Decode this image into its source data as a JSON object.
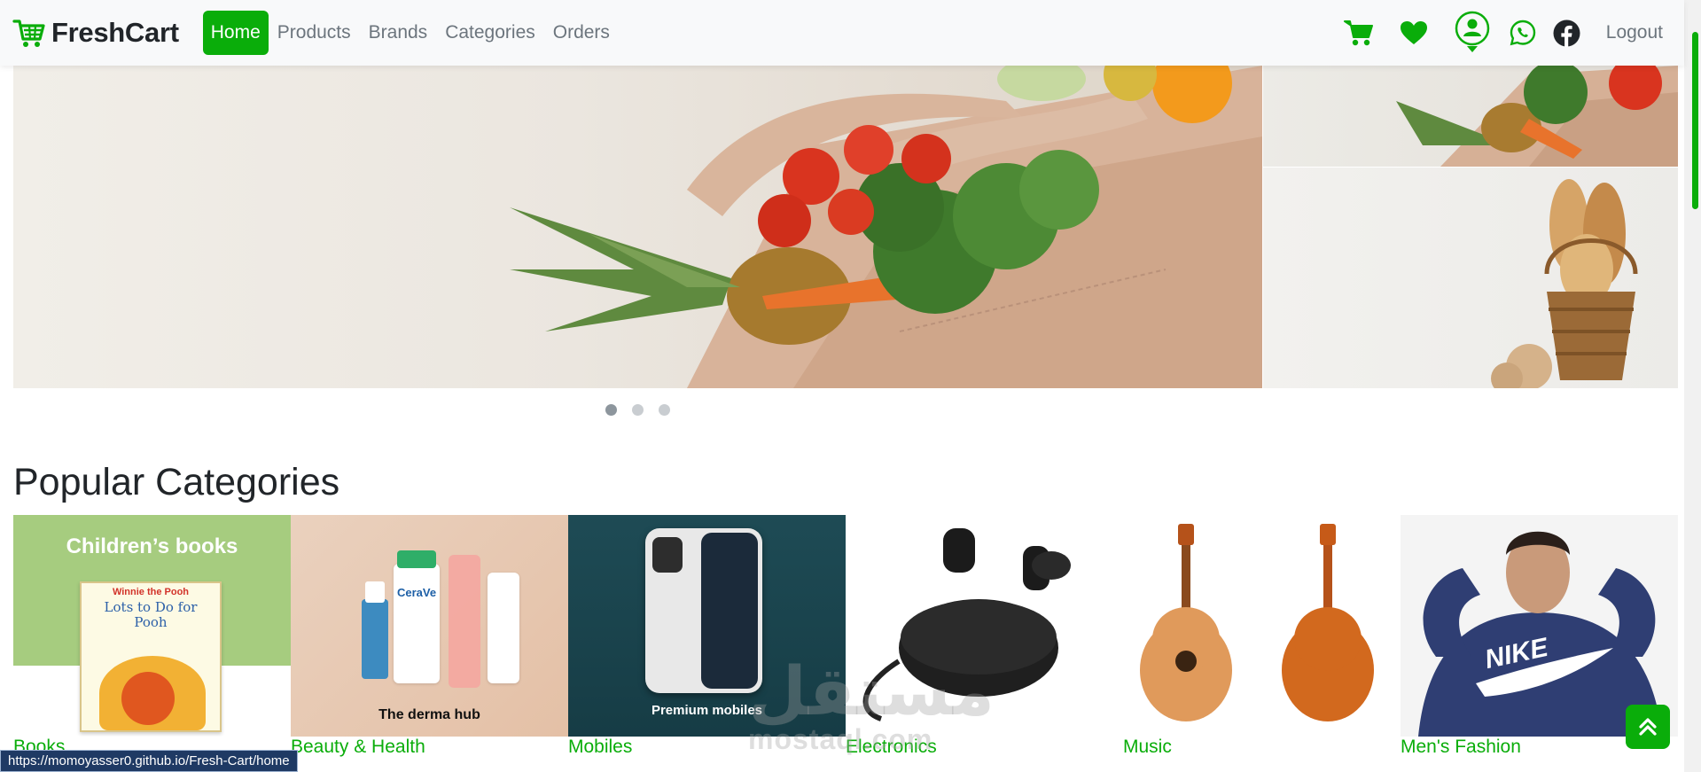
{
  "brand": {
    "name": "FreshCart",
    "icon": "cart-logo-icon",
    "color": "#0aad0a"
  },
  "nav": {
    "links": [
      {
        "label": "Home",
        "active": true
      },
      {
        "label": "Products",
        "active": false
      },
      {
        "label": "Brands",
        "active": false
      },
      {
        "label": "Categories",
        "active": false
      },
      {
        "label": "Orders",
        "active": false
      }
    ],
    "icons": [
      "cart-icon",
      "heart-icon",
      "user-icon",
      "whatsapp-icon",
      "facebook-icon"
    ],
    "logout": "Logout"
  },
  "slider": {
    "slides": 3,
    "active_slide": 1
  },
  "popular_categories": {
    "title": "Popular Categories",
    "items": [
      {
        "name": "Books",
        "image_caption": "Children’s books",
        "book_title": "Lots to Do for Pooh",
        "book_series": "Winnie the Pooh"
      },
      {
        "name": "Beauty & Health",
        "image_caption": "The derma hub",
        "product_brand": "CeraVe"
      },
      {
        "name": "Mobiles",
        "image_caption": "Premium mobiles"
      },
      {
        "name": "Electronics",
        "image_caption": ""
      },
      {
        "name": "Music",
        "image_caption": ""
      },
      {
        "name": "Men's Fashion",
        "image_caption": "",
        "apparel_brand": "NIKE"
      }
    ]
  },
  "watermark": {
    "arabic": "مستقل",
    "latin": "mostaql.com"
  },
  "status_bar": {
    "url": "https://momoyasser0.github.io/Fresh-Cart/home"
  },
  "accent_color": "#0aad0a"
}
